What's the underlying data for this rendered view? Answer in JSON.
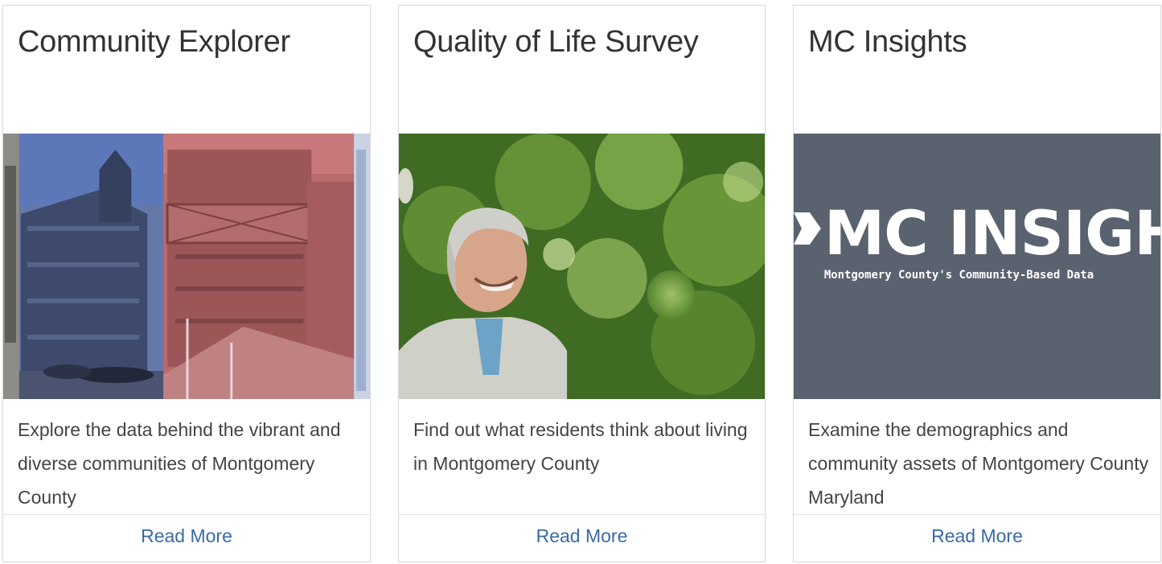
{
  "cards": [
    {
      "title": "Community Explorer",
      "description": "Explore the data behind the vibrant and diverse communities of Montgomery County",
      "link_label": "Read More",
      "image_icon": "city-buildings-photo"
    },
    {
      "title": "Quality of Life Survey",
      "description": "Find out what residents think about living in Montgomery County",
      "link_label": "Read More",
      "image_icon": "smiling-man-photo"
    },
    {
      "title": "MC Insights",
      "description": "Examine the demographics and community assets of Montgomery County Maryland",
      "link_label": "Read More",
      "image_icon": "mc-insights-logo",
      "logo": {
        "headline": "MC INSIGHTS",
        "tagline": "Montgomery County's Community-Based Data",
        "background": "#5a6270"
      }
    }
  ],
  "colors": {
    "link": "#3a6aa5",
    "title": "#333333",
    "body_text": "#444444",
    "border": "#d9d9d9"
  }
}
